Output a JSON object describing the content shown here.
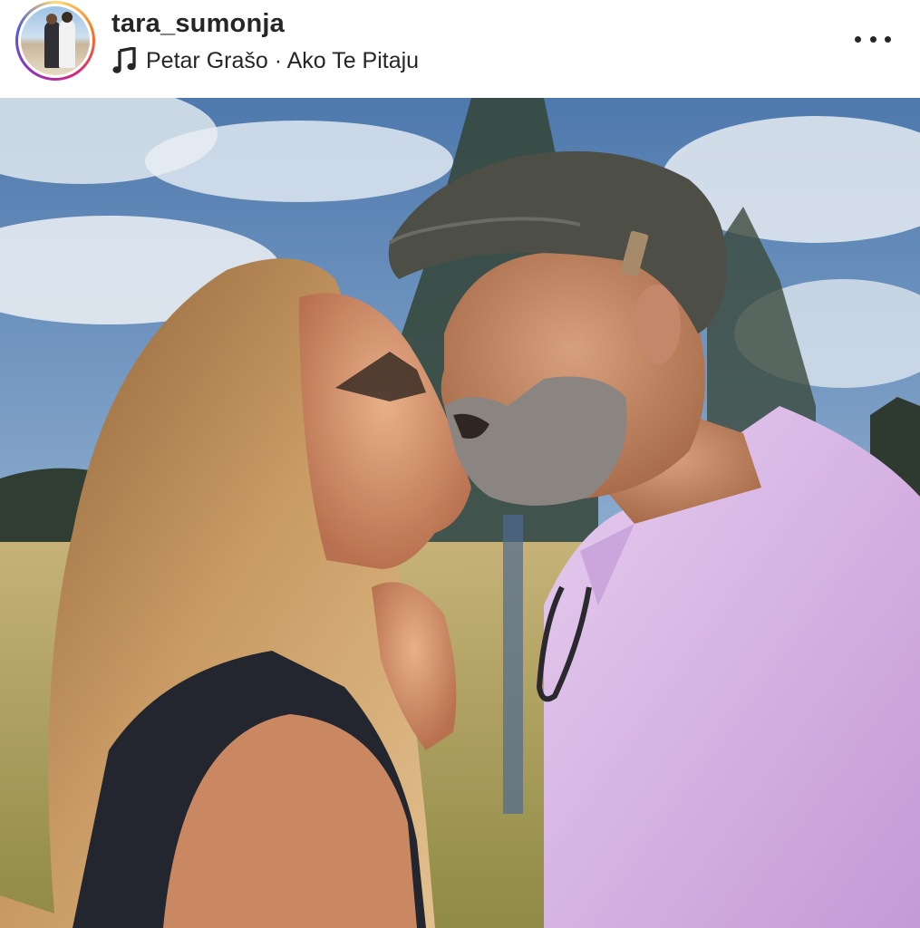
{
  "post": {
    "username": "tara_sumonja",
    "music": {
      "icon": "music-note-icon",
      "text": "Petar Grašo · Ako Te Pitaju"
    },
    "more_icon": "more-options-icon"
  },
  "photo": {
    "description_icon": "photo",
    "colors": {
      "sky": "#5f87b8",
      "cloud": "#e6edf3",
      "grass": "#b9a35c",
      "trees": "#3e4e3a",
      "shirt": "#d9b8e6",
      "cap": "#4d4e46",
      "hair": "#b98d55",
      "top": "#22252d",
      "skin": "#d69a74"
    }
  }
}
